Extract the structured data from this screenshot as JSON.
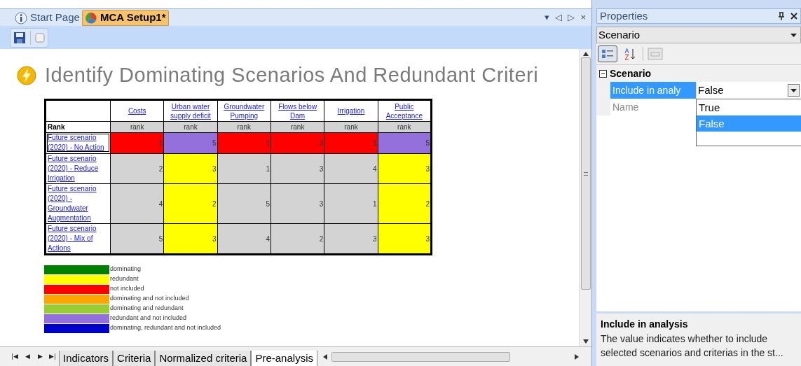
{
  "document_tabs": [
    {
      "label": "Start Page",
      "kind": "info",
      "selected": false
    },
    {
      "label": "MCA Setup1*",
      "kind": "pie",
      "selected": true
    }
  ],
  "tab_controls": [
    "▾",
    "◁",
    "▷",
    "×"
  ],
  "heading": "Identify Dominating Scenarios And Redundant Criteri",
  "table": {
    "row_header_label": "Rank",
    "columns": [
      {
        "name": "Costs",
        "unit": "rank"
      },
      {
        "name": "Urban water supply deficit",
        "unit": "rank"
      },
      {
        "name": "Groundwater Pumping",
        "unit": "rank"
      },
      {
        "name": "Flows below Dam",
        "unit": "rank"
      },
      {
        "name": "Irrigation",
        "unit": "rank"
      },
      {
        "name": "Public Acceptance",
        "unit": "rank"
      }
    ],
    "rows": [
      {
        "scenario": "Future scenario (2020) - No Action",
        "selected": true,
        "cells": [
          {
            "value": "1",
            "color": "#ff0000"
          },
          {
            "value": "5",
            "color": "#9370db"
          },
          {
            "value": "1",
            "color": "#ff0000"
          },
          {
            "value": "3",
            "color": "#ff0000"
          },
          {
            "value": "1",
            "color": "#ff0000"
          },
          {
            "value": "5",
            "color": "#9370db"
          }
        ]
      },
      {
        "scenario": "Future scenario (2020) - Reduce Irrigation",
        "selected": false,
        "cells": [
          {
            "value": "2",
            "color": "#d3d3d3"
          },
          {
            "value": "3",
            "color": "#ffff00"
          },
          {
            "value": "1",
            "color": "#d3d3d3"
          },
          {
            "value": "3",
            "color": "#d3d3d3"
          },
          {
            "value": "4",
            "color": "#d3d3d3"
          },
          {
            "value": "3",
            "color": "#ffff00"
          }
        ]
      },
      {
        "scenario": "Future scenario (2020) - Groundwater Augmentation",
        "selected": false,
        "cells": [
          {
            "value": "4",
            "color": "#d3d3d3"
          },
          {
            "value": "2",
            "color": "#ffff00"
          },
          {
            "value": "5",
            "color": "#d3d3d3"
          },
          {
            "value": "3",
            "color": "#d3d3d3"
          },
          {
            "value": "1",
            "color": "#d3d3d3"
          },
          {
            "value": "2",
            "color": "#ffff00"
          }
        ]
      },
      {
        "scenario": "Future scenario (2020) - Mix of Actions",
        "selected": false,
        "cells": [
          {
            "value": "5",
            "color": "#d3d3d3"
          },
          {
            "value": "3",
            "color": "#ffff00"
          },
          {
            "value": "4",
            "color": "#d3d3d3"
          },
          {
            "value": "2",
            "color": "#d3d3d3"
          },
          {
            "value": "3",
            "color": "#d3d3d3"
          },
          {
            "value": "3",
            "color": "#ffff00"
          }
        ]
      }
    ]
  },
  "legend": [
    {
      "label": "dominating",
      "color": "#008000"
    },
    {
      "label": "redundant",
      "color": "#ffff00"
    },
    {
      "label": "not included",
      "color": "#ff0000"
    },
    {
      "label": "dominating and not included",
      "color": "#ffa500"
    },
    {
      "label": "dominating and redundant",
      "color": "#9acd32"
    },
    {
      "label": "redundant and not included",
      "color": "#9370db"
    },
    {
      "label": "dominating, redundant and not included",
      "color": "#0000cd"
    }
  ],
  "sheet_nav": [
    "|◀",
    "◀",
    "▶",
    "▶|"
  ],
  "sheet_tabs": [
    {
      "label": "Indicators",
      "selected": false
    },
    {
      "label": "Criteria",
      "selected": false
    },
    {
      "label": "Normalized criteria",
      "selected": false
    },
    {
      "label": "Pre-analysis",
      "selected": true
    }
  ],
  "properties": {
    "title": "Properties",
    "object": "Scenario",
    "sort": {
      "categorized": true
    },
    "category": {
      "name": "Scenario",
      "expanded": true,
      "properties": [
        {
          "name": "Include in analy",
          "value": "False",
          "selected": true
        },
        {
          "name": "Name",
          "selected": false
        }
      ]
    },
    "dropdown": [
      {
        "label": "True",
        "selected": false
      },
      {
        "label": "False",
        "selected": true
      }
    ],
    "description": {
      "title": "Include in analysis",
      "text": "The value indicates whether to include selected scenarios and criterias in the st..."
    }
  }
}
